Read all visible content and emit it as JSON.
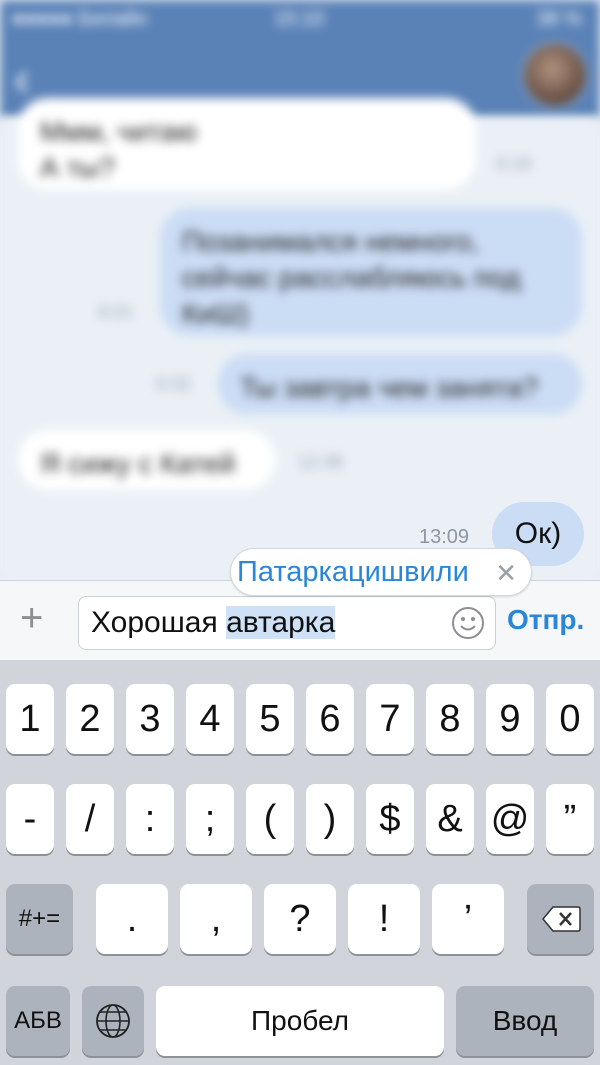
{
  "status_bar": {
    "carrier": "●●●●● Билайн",
    "time": "15:10",
    "battery": "38 %"
  },
  "chat": {
    "messages_blurred": [
      {
        "text": "Ммм, читаю\nА ты?",
        "time": "0:19"
      },
      {
        "text": "Позанимался немного,\nсейчас расслабляюсь под\nКиШ)",
        "time": "0:21"
      },
      {
        "text": "Ты завтра чем занята?",
        "time": "0:32"
      },
      {
        "text": "Я сижу с Катей",
        "time": "12:36"
      }
    ],
    "last_message": {
      "text": "Ок)",
      "time": "13:09"
    }
  },
  "autocorrect": {
    "suggestion": "Патаркацишвили",
    "dismiss": "✕"
  },
  "composer": {
    "plus": "+",
    "text_before": "Хорошая ",
    "text_selected": "автарка",
    "send_label": "Отпр."
  },
  "keyboard": {
    "row1": [
      "1",
      "2",
      "3",
      "4",
      "5",
      "6",
      "7",
      "8",
      "9",
      "0"
    ],
    "row2": [
      "-",
      "/",
      ":",
      ";",
      "(",
      ")",
      "$",
      "&",
      "@",
      "”"
    ],
    "row3": [
      ".",
      ",",
      "?",
      "!",
      "’"
    ],
    "shift_label": "#+=",
    "abc_label": "АБВ",
    "space_label": "Пробел",
    "return_label": "Ввод"
  }
}
